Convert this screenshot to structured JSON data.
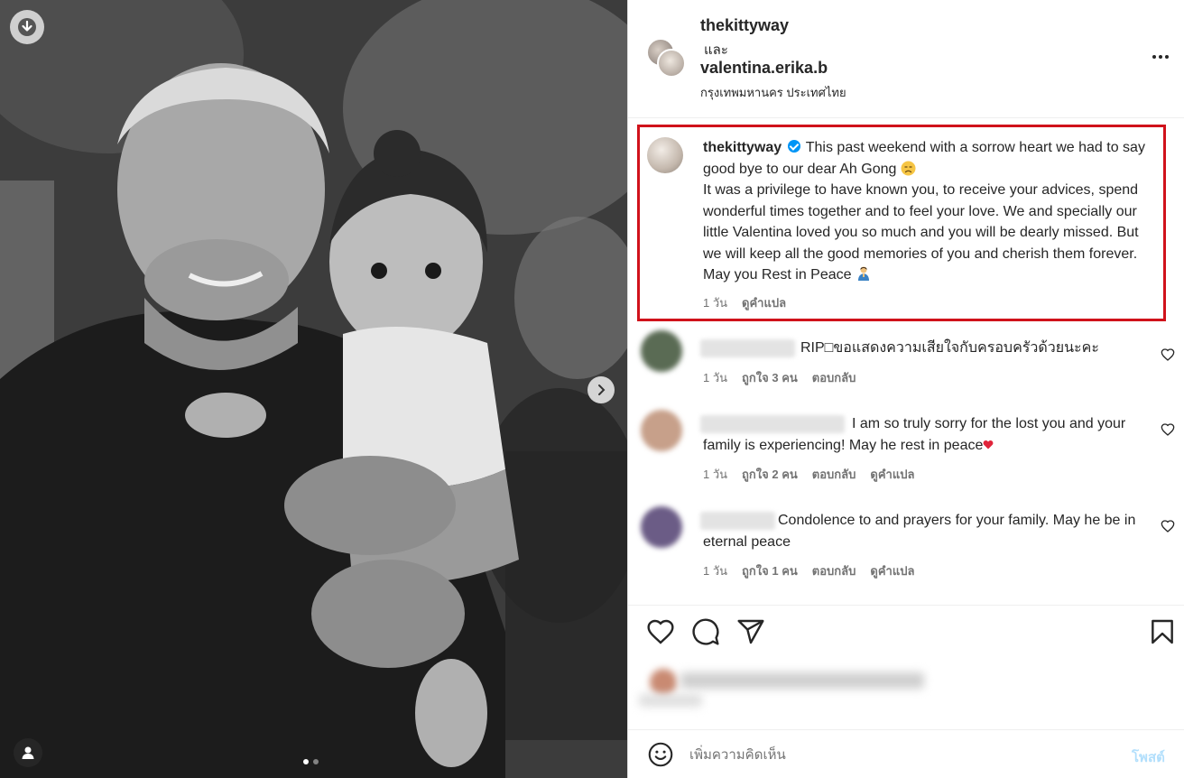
{
  "colors": {
    "accent": "#0095f6",
    "highlight_border": "#d0121b",
    "muted": "#737373",
    "text": "#262626"
  },
  "photo": {
    "download_icon": "arrow-down-circle-icon",
    "next_icon": "chevron-right-icon",
    "tag_icon": "user-tag-icon",
    "carousel_total": 2,
    "carousel_active": 1
  },
  "header": {
    "user1": "thekittyway",
    "and_word": "และ",
    "user2": "valentina.erika.b",
    "location": "กรุงเทพมหานคร ประเทศไทย",
    "more_icon": "more-horizontal-icon"
  },
  "caption": {
    "username": "thekittyway",
    "line1": "This past weekend with a sorrow heart we had to say good bye to our dear Ah Gong",
    "body": "It was a privilege to have known you, to receive your advices, spend wonderful times together and to feel your love. We and specially our little Valentina loved you so much and you will be dearly missed. But we will keep all the good memories of you and cherish them forever. May you Rest in Peace",
    "time": "1 วัน",
    "translate": "ดูคำแปล"
  },
  "comments": [
    {
      "text": "RIP□ขอแสดงความเสียใจกับครอบครัวด้วยนะคะ",
      "time": "1 วัน",
      "likes": "ถูกใจ 3 คน",
      "reply": "ตอบกลับ",
      "translate": ""
    },
    {
      "text": "I am so truly sorry for the lost you and your family is experiencing! May he rest in peace",
      "time": "1 วัน",
      "likes": "ถูกใจ 2 คน",
      "reply": "ตอบกลับ",
      "translate": "ดูคำแปล"
    },
    {
      "text": "Condolence to and prayers for your family. May he be in eternal peace",
      "time": "1 วัน",
      "likes": "ถูกใจ 1 คน",
      "reply": "ตอบกลับ",
      "translate": "ดูคำแปล"
    }
  ],
  "actions": {
    "like_icon": "heart-icon",
    "comment_icon": "comment-bubble-icon",
    "share_icon": "paper-plane-icon",
    "save_icon": "bookmark-icon"
  },
  "add_comment": {
    "placeholder": "เพิ่มความคิดเห็น",
    "post_label": "โพสต์",
    "emoji_icon": "smiley-icon"
  }
}
